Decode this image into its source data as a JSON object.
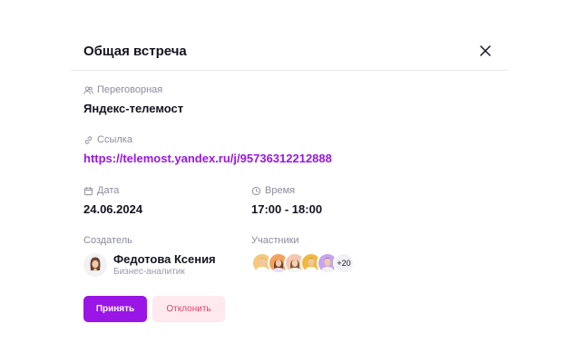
{
  "dialog": {
    "title": "Общая встреча"
  },
  "room": {
    "label": "Переговорная",
    "value": "Яндекс-телемост"
  },
  "link": {
    "label": "Ссылка",
    "value": "https://telemost.yandex.ru/j/95736312212888"
  },
  "date": {
    "label": "Дата",
    "value": "24.06.2024"
  },
  "time": {
    "label": "Время",
    "value": "17:00 - 18:00"
  },
  "creator": {
    "label": "Создатель",
    "name": "Федотова Ксения",
    "role": "Бизнес-аналитик"
  },
  "participants": {
    "label": "Участники",
    "more": "+20",
    "avatar_colors": [
      "#f6c879",
      "#f3a25d",
      "#f4c8b0",
      "#f0b93e",
      "#c6a4f0"
    ]
  },
  "actions": {
    "accept": "Принять",
    "decline": "Отклонить"
  },
  "colors": {
    "accent": "#9a16e6",
    "decline_bg": "#fde9ee",
    "decline_text": "#e0446b"
  }
}
